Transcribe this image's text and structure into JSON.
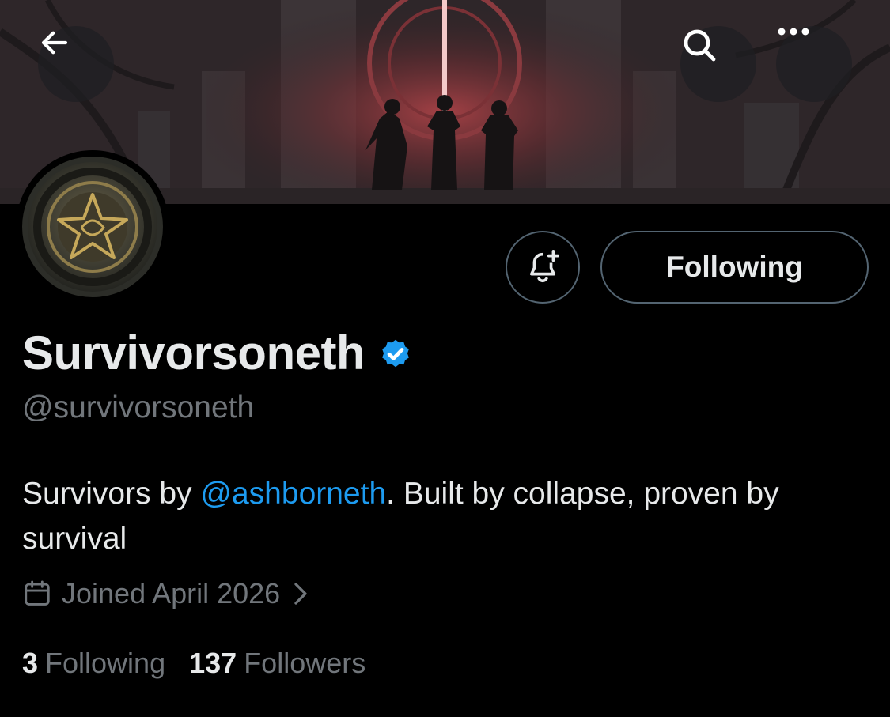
{
  "header": {
    "back_icon": "arrow-left-icon",
    "search_icon": "search-icon",
    "more_icon": "more-horizontal-icon"
  },
  "profile": {
    "display_name": "Survivorsoneth",
    "verified": true,
    "handle": "@survivorsoneth",
    "bio_prefix": "Survivors by ",
    "bio_mention": "@ashborneth",
    "bio_suffix": ". Built by collapse, proven by survival",
    "joined": "Joined April 2026",
    "following_count": "3",
    "following_label": "Following",
    "followers_count": "137",
    "followers_label": "Followers"
  },
  "actions": {
    "notify_icon": "bell-plus-icon",
    "following_button": "Following"
  },
  "colors": {
    "background": "#000000",
    "primary_text": "#e7e9ea",
    "secondary_text": "#71767b",
    "accent": "#1d9bf0",
    "verified_badge": "#1d9bf0",
    "button_border": "#536471"
  }
}
